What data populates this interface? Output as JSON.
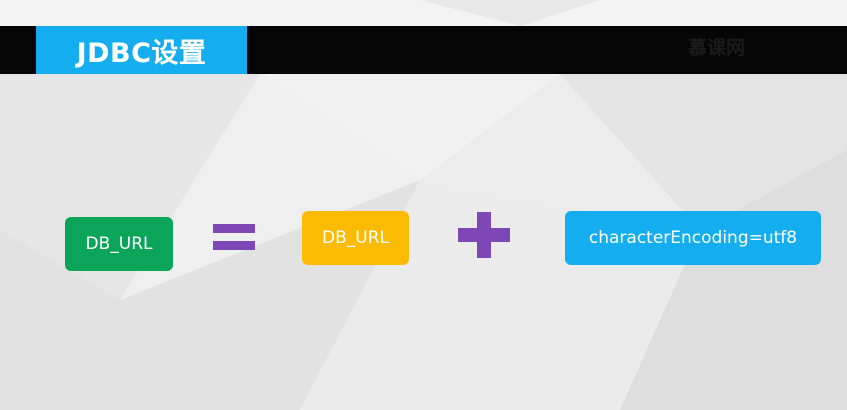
{
  "header": {
    "title": "JDBC设置",
    "corner_text": "慕课网"
  },
  "equation": {
    "left_term": "DB_URL",
    "right_term_1": "DB_URL",
    "right_term_2": "characterEncoding=utf8",
    "operator_1": "=",
    "operator_2": "+"
  },
  "colors": {
    "header_bar": "#050505",
    "title_box": "#14aef0",
    "left_term_box": "#0aa559",
    "right_term_1_box": "#fbbb03",
    "right_term_2_box": "#14aef0",
    "operators": "#7d47b5",
    "background": "#e9e9e9"
  }
}
